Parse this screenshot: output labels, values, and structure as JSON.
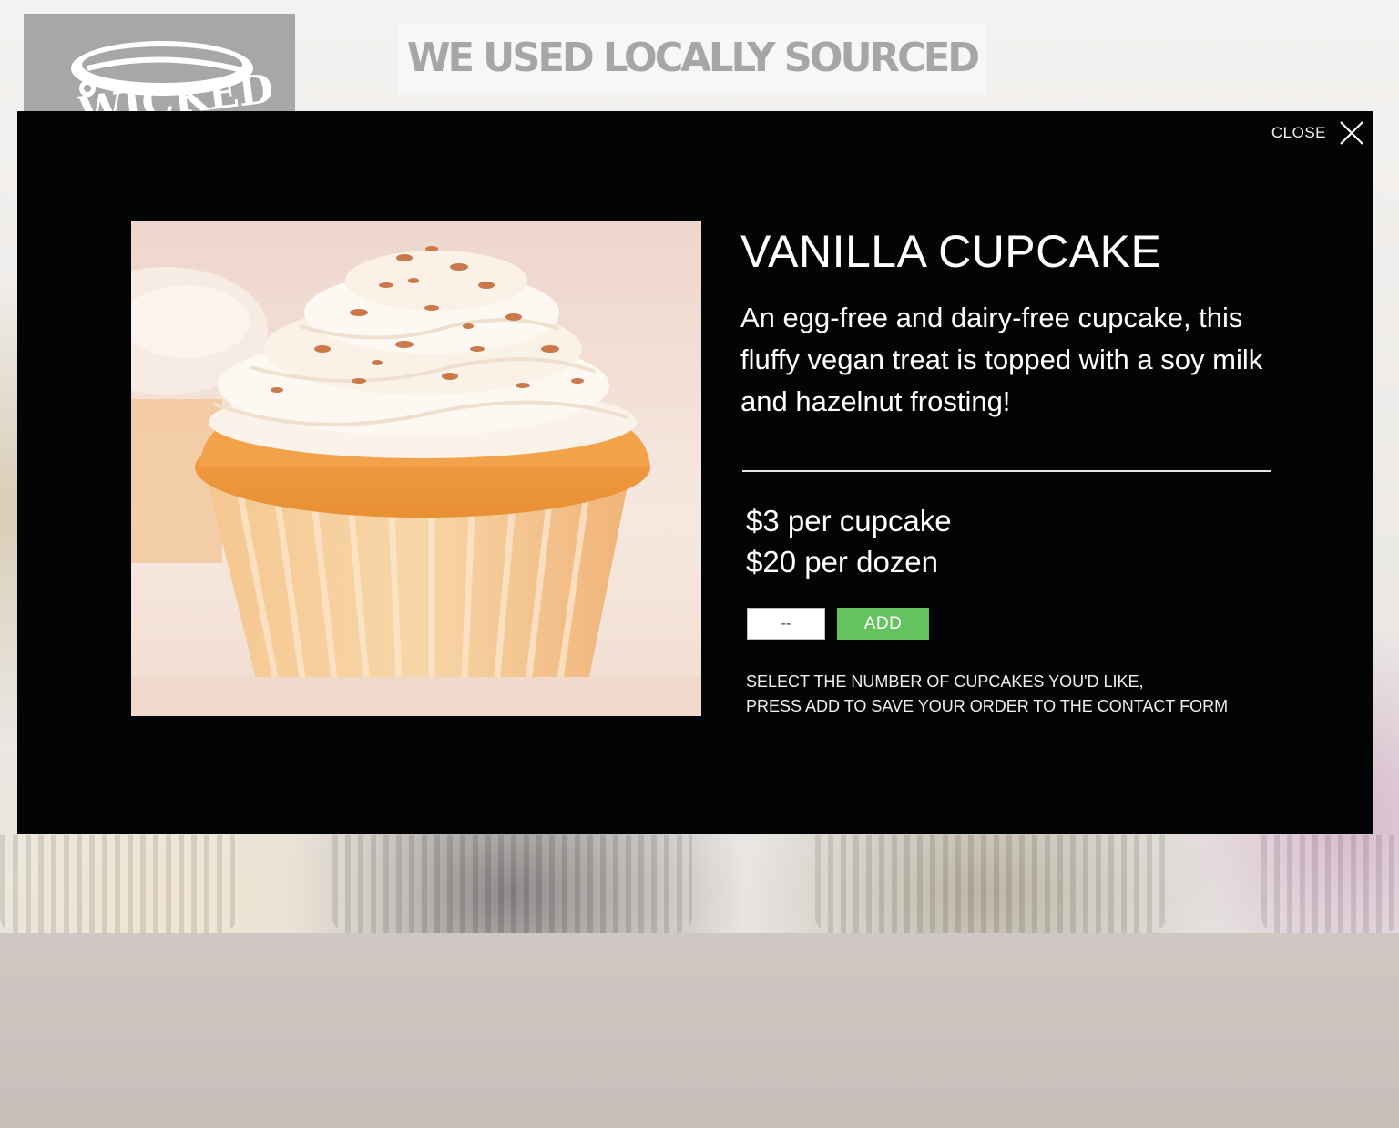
{
  "background": {
    "headline": "WE USED LOCALLY SOURCED",
    "logo_text": "WICKED"
  },
  "modal": {
    "close_label": "CLOSE",
    "close_icon": "close-x-icon",
    "product_image": "vanilla-cupcake-photo",
    "title": "VANILLA CUPCAKE",
    "description": "An egg-free and dairy-free cupcake, this fluffy vegan treat is topped with a soy milk and hazelnut frosting!",
    "prices": [
      "$3 per cupcake",
      "$20 per dozen"
    ],
    "quantity": {
      "value": "--"
    },
    "add_label": "ADD",
    "instructions": [
      "SELECT  THE NUMBER OF CUPCAKES  YOU'D LIKE,",
      "PRESS ADD TO SAVE YOUR ORDER TO THE CONTACT FORM"
    ],
    "colors": {
      "background": "#030405",
      "add_button": "#64c35f",
      "text": "#ffffff"
    }
  }
}
